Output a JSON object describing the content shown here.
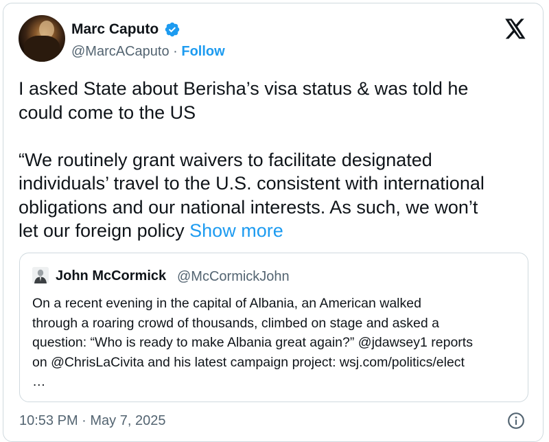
{
  "author": {
    "name": "Marc Caputo",
    "handle": "@MarcACaputo",
    "separator": "·",
    "follow_label": "Follow"
  },
  "tweet": {
    "paragraphs": [
      [
        "I asked State about Berisha’s visa status & was told he",
        "could come to the US"
      ],
      [
        "“We routinely grant waivers to facilitate designated",
        "individuals’ travel to the U.S. consistent with international",
        "obligations and our national interests. As such, we won’t"
      ]
    ],
    "last_line_prefix": "let our foreign policy",
    "show_more_label": "Show more"
  },
  "quote": {
    "name": "John McCormick",
    "handle": "@McCormickJohn",
    "lines": [
      "On a recent evening in the capital of Albania, an American walked",
      "through a roaring crowd of thousands, climbed on stage and asked a",
      "question: “Who is ready to make Albania great again?” @jdawsey1 reports",
      "on @ChrisLaCivita and his latest campaign project: wsj.com/politics/elect",
      "…"
    ]
  },
  "timestamp": "10:53 PM · May 7, 2025",
  "icons": {
    "verified": "verified-badge-icon",
    "platform": "x-logo-icon",
    "info": "info-icon"
  },
  "colors": {
    "accent": "#1d9bf0",
    "text": "#0f1419",
    "secondary": "#536471",
    "border": "#cfd9de"
  }
}
